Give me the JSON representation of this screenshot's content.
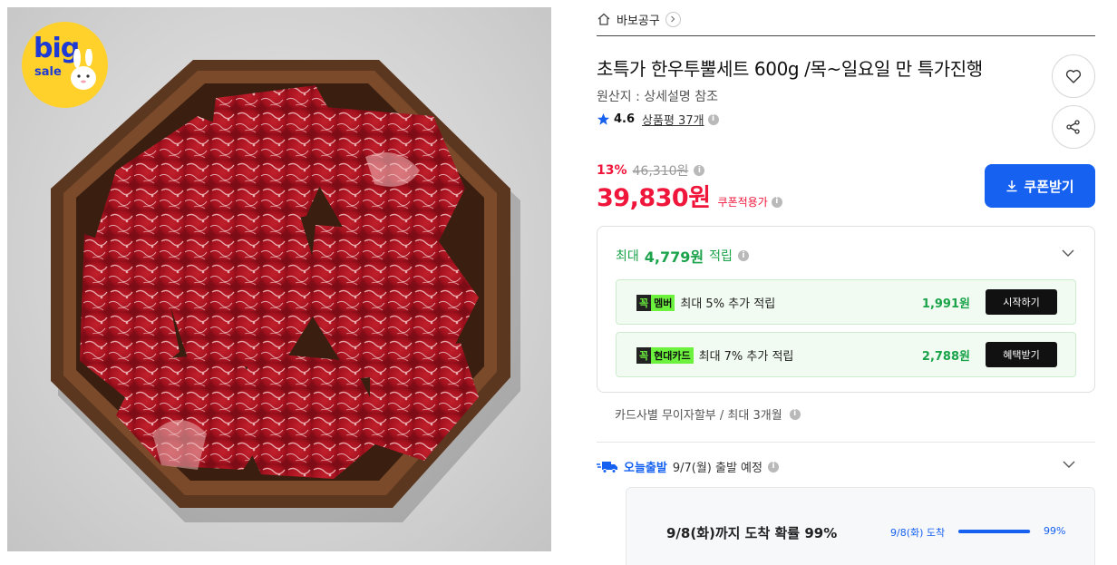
{
  "badge": {
    "big": "big",
    "sale": "sale"
  },
  "brand": {
    "name": "바보공구"
  },
  "product": {
    "title": "초특가 한우투뿔세트 600g /목~일요일 만 특가진행",
    "origin": "원산지 : 상세설명 참조",
    "rating": "4.6",
    "review_label": "상품평 37개"
  },
  "price": {
    "discount": "13%",
    "original": "46,310원",
    "sale": "39,830원",
    "coupon_note": "쿠폰적용가"
  },
  "coupon_button": {
    "label": "쿠폰받기"
  },
  "reward": {
    "prefix": "최대",
    "amount": "4,779원",
    "suffix": "적립",
    "cards": [
      {
        "badge_dark": "꼭",
        "badge_light": "멤버",
        "text": "최대 5% 추가 적립",
        "amount": "1,991원",
        "button": "시작하기"
      },
      {
        "badge_dark": "꼭",
        "badge_light": "현대카드",
        "text": "최대 7% 추가 적립",
        "amount": "2,788원",
        "button": "혜택받기"
      }
    ]
  },
  "installment": {
    "text": "카드사별 무이자할부 / 최대 3개월"
  },
  "delivery": {
    "badge": "오늘출발",
    "text": "9/7(월) 출발 예정",
    "arrival_main": "9/8(화)까지 도착 확률 99%",
    "arrival_sub": "9/8(화) 도착",
    "arrival_pct": "99%",
    "arrival_fraction": 0.99
  },
  "colors": {
    "accent_red": "#f0153a",
    "accent_blue": "#1661f0",
    "accent_green": "#1aa34a",
    "badge_yellow": "#ffd12a"
  },
  "icons": [
    "home-icon",
    "chevron-right-icon",
    "heart-icon",
    "share-icon",
    "star-icon",
    "info-icon",
    "download-icon",
    "chevron-down-icon",
    "truck-icon"
  ]
}
